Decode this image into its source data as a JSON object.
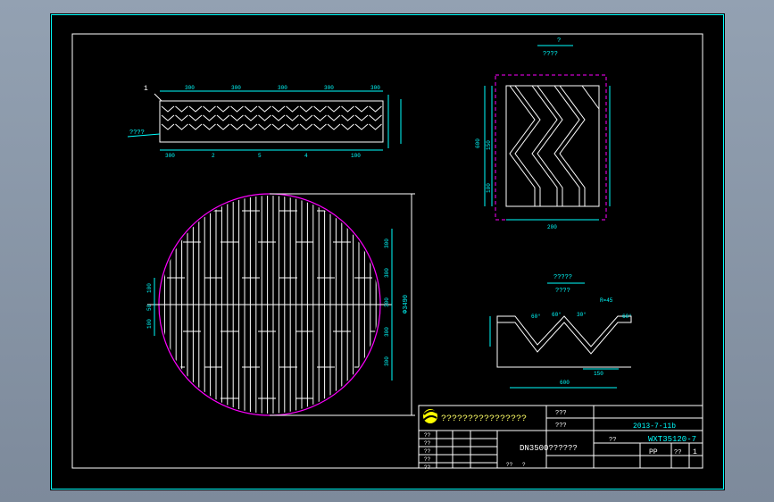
{
  "title_block": {
    "company": "????????????????",
    "date": "2013-7-11b",
    "part_name": "DN3500??????",
    "drawing_no": "WXT35120-7",
    "label_top": "???",
    "label_mid": "???",
    "label_bot": "??",
    "material": "PP",
    "scale_label": "??",
    "scale_value": "1",
    "left_rows": [
      "??",
      "??",
      "??",
      "??",
      "??"
    ],
    "bottom_cells": [
      "??",
      "?"
    ]
  },
  "views": {
    "detail_title": "?",
    "detail_subtitle": "????",
    "profile_title": "?????",
    "profile_subtitle": "????",
    "callout_1": "1",
    "side_label": "????"
  },
  "dims": {
    "plan_diameter": "Φ3490",
    "top_strip": [
      "300",
      "300",
      "300",
      "300",
      "300"
    ],
    "bottom_strip": [
      "300",
      "2",
      "5",
      "4",
      "100"
    ],
    "right_side": [
      "300",
      "300",
      "300",
      "300",
      "300"
    ],
    "left_side": [
      "100",
      "50",
      "100"
    ],
    "detail_bottom": [
      "200"
    ],
    "detail_left": [
      "600",
      "150",
      "100"
    ],
    "profile_bottom": [
      "600",
      "150"
    ],
    "profile_angles": [
      "60°",
      "60°",
      "30°",
      "60°"
    ],
    "profile_label": "R=45"
  }
}
